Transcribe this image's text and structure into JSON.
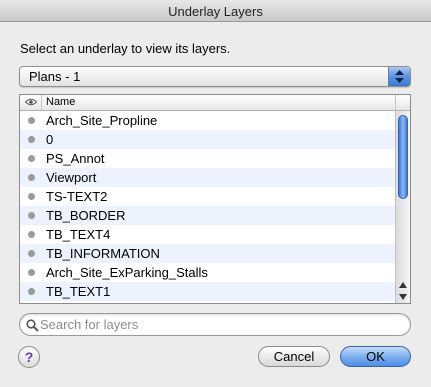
{
  "window": {
    "title": "Underlay Layers"
  },
  "prompt": "Select an underlay to view its layers.",
  "underlay_select": {
    "value": "Plans - 1"
  },
  "table": {
    "header": {
      "visibility_icon": "eye-icon",
      "name_label": "Name"
    },
    "rows": [
      {
        "name": "Arch_Site_Propline"
      },
      {
        "name": "0"
      },
      {
        "name": "PS_Annot"
      },
      {
        "name": "Viewport"
      },
      {
        "name": "TS-TEXT2"
      },
      {
        "name": "TB_BORDER"
      },
      {
        "name": "TB_TEXT4"
      },
      {
        "name": "TB_INFORMATION"
      },
      {
        "name": "Arch_Site_ExParking_Stalls"
      },
      {
        "name": "TB_TEXT1"
      }
    ]
  },
  "search": {
    "placeholder": "Search for layers",
    "value": ""
  },
  "buttons": {
    "help_label": "?",
    "cancel_label": "Cancel",
    "ok_label": "OK"
  }
}
